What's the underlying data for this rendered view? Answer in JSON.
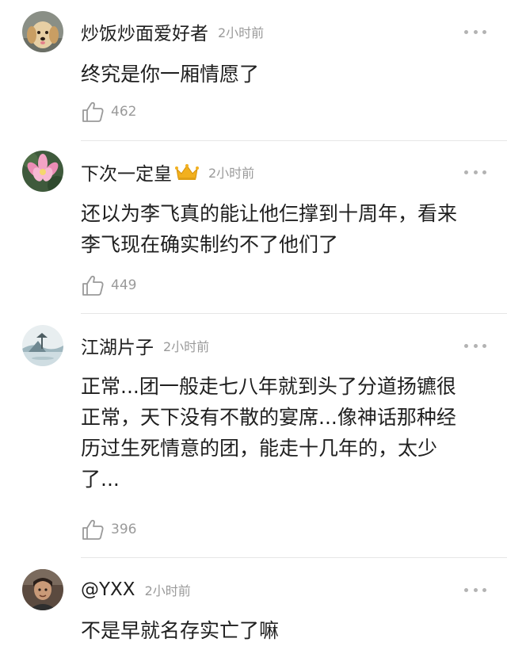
{
  "comments": [
    {
      "username": "炒饭炒面爱好者",
      "time": "2小时前",
      "lines": [
        "终究是你一厢情愿了"
      ],
      "likes": "462",
      "avatar_icon": "puppy-avatar-icon",
      "has_crown": false
    },
    {
      "username": "下次一定皇",
      "time": "2小时前",
      "lines": [
        "还以为李飞真的能让他仨撑到十周年，看来",
        "李飞现在确实制约不了他们了"
      ],
      "likes": "449",
      "avatar_icon": "lotus-avatar-icon",
      "has_crown": true
    },
    {
      "username": "江湖片子",
      "time": "2小时前",
      "lines": [
        "正常...团一般走七八年就到头了分道扬镳很",
        "正常，天下没有不散的宴席...像神话那种经",
        "历过生死情意的团，能走十几年的，太少",
        "了..."
      ],
      "likes": "396",
      "avatar_icon": "landscape-avatar-icon",
      "has_crown": false
    },
    {
      "username": "@YXX",
      "time": "2小时前",
      "lines": [
        "不是早就名存实亡了嘛"
      ],
      "likes": "",
      "avatar_icon": "person-avatar-icon",
      "has_crown": false
    }
  ],
  "icons": {
    "like": "thumbs-up-icon",
    "more": "more-options-icon",
    "crown": "crown-icon"
  },
  "colors": {
    "text": "#1f1f1f",
    "meta": "#9a9a9a",
    "divider": "#e6e6e6",
    "crown": "#f2b01e"
  }
}
